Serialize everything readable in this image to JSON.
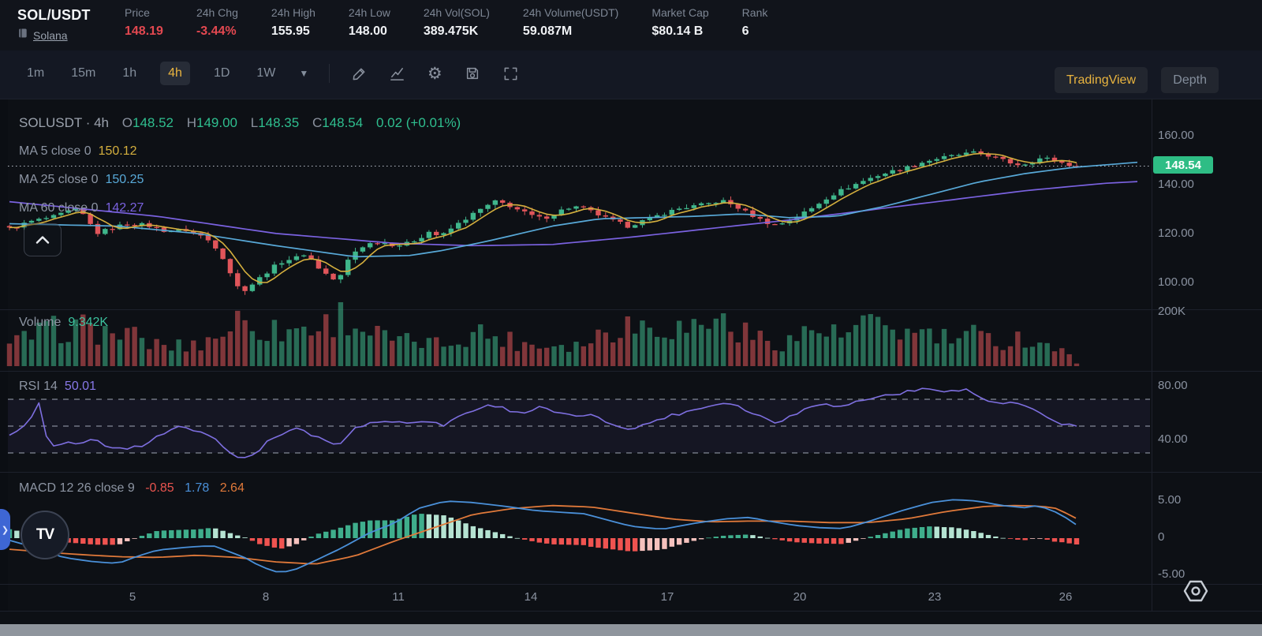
{
  "header": {
    "symbol": "SOL/USDT",
    "network": "Solana",
    "stats": [
      {
        "label": "Price",
        "value": "148.19"
      },
      {
        "label": "24h Chg",
        "value": "-3.44%"
      },
      {
        "label": "24h High",
        "value": "155.95"
      },
      {
        "label": "24h Low",
        "value": "148.00"
      },
      {
        "label": "24h Vol(SOL)",
        "value": "389.475K"
      },
      {
        "label": "24h Volume(USDT)",
        "value": "59.087M"
      },
      {
        "label": "Market Cap",
        "value": "$80.14 B"
      },
      {
        "label": "Rank",
        "value": "6"
      }
    ]
  },
  "toolbar": {
    "timeframes": [
      "1m",
      "15m",
      "1h",
      "4h",
      "1D",
      "1W"
    ],
    "active_timeframe": "4h",
    "view_buttons": {
      "tradingview": "TradingView",
      "depth": "Depth"
    }
  },
  "legend": {
    "symbol_interval": "SOLUSDT · 4h",
    "ohlc": {
      "o_label": "O",
      "o": "148.52",
      "h_label": "H",
      "h": "149.00",
      "l_label": "L",
      "l": "148.35",
      "c_label": "C",
      "c": "148.54",
      "change": "0.02 (+0.01%)"
    },
    "ma5": {
      "label": "MA 5 close 0",
      "value": "150.12"
    },
    "ma25": {
      "label": "MA 25 close 0",
      "value": "150.25"
    },
    "ma60": {
      "label": "MA 60 close 0",
      "value": "142.27"
    },
    "volume": {
      "label": "Volume",
      "value": "9.342K"
    },
    "rsi": {
      "label": "RSI 14",
      "value": "50.01"
    },
    "macd": {
      "label": "MACD 12 26 close 9",
      "hist": "-0.85",
      "macd": "1.78",
      "signal": "2.64"
    }
  },
  "colors": {
    "accent_gold": "#e9b43f",
    "stat_red": "#e34850",
    "up_green": "#3fb68b",
    "down_red": "#e0555a",
    "price_badge": "#2ebd85",
    "ma5": "#d4af3e",
    "ma25": "#58a9d8",
    "ma60": "#7a62e0",
    "rsi": "#7e6fe0",
    "macd_line": "#4a90d9",
    "macd_signal": "#e0793a",
    "hist_up": "#3fae8c",
    "hist_up_fade": "#b5e3d2",
    "hist_down": "#ef5350",
    "hist_down_fade": "#f5c1bd"
  },
  "chart_data": {
    "type": "candlestick",
    "symbol": "SOLUSDT",
    "interval": "4h",
    "ohlc_current": {
      "open": 148.52,
      "high": 149.0,
      "low": 148.35,
      "close": 148.54,
      "change": 0.02,
      "change_pct": "+0.01%"
    },
    "price_axis": {
      "labels": [
        "160.00",
        "140.00",
        "120.00",
        "100.00"
      ],
      "values": [
        160,
        140,
        120,
        100
      ],
      "last_price": 148.54,
      "last_price_label": "148.54",
      "range": [
        93,
        166
      ]
    },
    "time_axis": {
      "labels": [
        "5",
        "8",
        "11",
        "14",
        "17",
        "20",
        "23",
        "26"
      ]
    },
    "volume_axis": {
      "labels": [
        "200K"
      ],
      "max_thousands": 200,
      "current": 9.342
    },
    "rsi_axis": {
      "labels": [
        "80.00",
        "40.00"
      ],
      "levels": [
        70,
        50,
        30
      ],
      "current": 50.01
    },
    "macd_axis": {
      "labels": [
        "5.00",
        "0",
        "-5.00"
      ],
      "current": {
        "hist": -0.85,
        "macd": 1.78,
        "signal": 2.64
      }
    },
    "candles": {
      "count": 146,
      "close_keyframes": [
        [
          12,
          123
        ],
        [
          40,
          126
        ],
        [
          70,
          128
        ],
        [
          95,
          131
        ],
        [
          108,
          128
        ],
        [
          122,
          121
        ],
        [
          140,
          123
        ],
        [
          160,
          125
        ],
        [
          185,
          124.5
        ],
        [
          210,
          122
        ],
        [
          235,
          122.5
        ],
        [
          255,
          120
        ],
        [
          270,
          117
        ],
        [
          283,
          111
        ],
        [
          295,
          103
        ],
        [
          305,
          97
        ],
        [
          315,
          99
        ],
        [
          330,
          103
        ],
        [
          345,
          107
        ],
        [
          360,
          110
        ],
        [
          375,
          111
        ],
        [
          388,
          113
        ],
        [
          400,
          108
        ],
        [
          415,
          104
        ],
        [
          428,
          101
        ],
        [
          441,
          110
        ],
        [
          454,
          115
        ],
        [
          470,
          117
        ],
        [
          486,
          117.5
        ],
        [
          502,
          116
        ],
        [
          517,
          117
        ],
        [
          531,
          119
        ],
        [
          545,
          122
        ],
        [
          558,
          119.5
        ],
        [
          572,
          123
        ],
        [
          590,
          127
        ],
        [
          610,
          131
        ],
        [
          628,
          134
        ],
        [
          642,
          133
        ],
        [
          658,
          130.5
        ],
        [
          672,
          128.5
        ],
        [
          688,
          127
        ],
        [
          702,
          129
        ],
        [
          715,
          131
        ],
        [
          728,
          132
        ],
        [
          742,
          131
        ],
        [
          756,
          129
        ],
        [
          770,
          127
        ],
        [
          783,
          125.5
        ],
        [
          796,
          124
        ],
        [
          809,
          125.5
        ],
        [
          823,
          127
        ],
        [
          840,
          129
        ],
        [
          858,
          131
        ],
        [
          876,
          132
        ],
        [
          895,
          133
        ],
        [
          915,
          134.5
        ],
        [
          933,
          132
        ],
        [
          950,
          129
        ],
        [
          965,
          126.5
        ],
        [
          980,
          124.5
        ],
        [
          995,
          125.5
        ],
        [
          1010,
          128
        ],
        [
          1028,
          131
        ],
        [
          1045,
          135
        ],
        [
          1062,
          138
        ],
        [
          1080,
          140.5
        ],
        [
          1098,
          143
        ],
        [
          1115,
          145
        ],
        [
          1132,
          146.5
        ],
        [
          1150,
          148
        ],
        [
          1168,
          150
        ],
        [
          1186,
          151.5
        ],
        [
          1204,
          152.5
        ],
        [
          1222,
          153.5
        ],
        [
          1238,
          154
        ],
        [
          1252,
          153
        ],
        [
          1266,
          151.5
        ],
        [
          1280,
          150
        ],
        [
          1294,
          149
        ],
        [
          1308,
          150.5
        ],
        [
          1322,
          152
        ],
        [
          1336,
          151
        ],
        [
          1350,
          149.5
        ],
        [
          1365,
          148.5
        ]
      ]
    },
    "ma25_keyframes": [
      [
        12,
        125
      ],
      [
        150,
        124
      ],
      [
        250,
        121
      ],
      [
        350,
        116
      ],
      [
        450,
        111.5
      ],
      [
        520,
        112
      ],
      [
        560,
        114
      ],
      [
        620,
        118
      ],
      [
        700,
        124
      ],
      [
        760,
        127
      ],
      [
        820,
        127.5
      ],
      [
        880,
        128
      ],
      [
        940,
        129
      ],
      [
        1000,
        127.5
      ],
      [
        1060,
        128
      ],
      [
        1120,
        132
      ],
      [
        1180,
        137
      ],
      [
        1240,
        142
      ],
      [
        1300,
        145.5
      ],
      [
        1360,
        148
      ],
      [
        1446,
        150.2
      ]
    ],
    "ma60_keyframes": [
      [
        12,
        134
      ],
      [
        200,
        128
      ],
      [
        350,
        121
      ],
      [
        500,
        117
      ],
      [
        600,
        116
      ],
      [
        700,
        116.5
      ],
      [
        800,
        119.5
      ],
      [
        900,
        123
      ],
      [
        1000,
        126.5
      ],
      [
        1100,
        130.5
      ],
      [
        1200,
        134.5
      ],
      [
        1300,
        138.5
      ],
      [
        1400,
        141.5
      ],
      [
        1446,
        142.3
      ]
    ],
    "volume_keyframes": [
      [
        12,
        70
      ],
      [
        40,
        110
      ],
      [
        70,
        130
      ],
      [
        100,
        140
      ],
      [
        130,
        120
      ],
      [
        160,
        115
      ],
      [
        190,
        80
      ],
      [
        220,
        70
      ],
      [
        250,
        78
      ],
      [
        280,
        115
      ],
      [
        300,
        165
      ],
      [
        320,
        150
      ],
      [
        340,
        130
      ],
      [
        360,
        122
      ],
      [
        380,
        140
      ],
      [
        400,
        132
      ],
      [
        420,
        160
      ],
      [
        435,
        185
      ],
      [
        450,
        150
      ],
      [
        470,
        120
      ],
      [
        490,
        100
      ],
      [
        510,
        82
      ],
      [
        530,
        92
      ],
      [
        550,
        76
      ],
      [
        570,
        86
      ],
      [
        590,
        112
      ],
      [
        610,
        122
      ],
      [
        630,
        102
      ],
      [
        650,
        92
      ],
      [
        670,
        80
      ],
      [
        690,
        72
      ],
      [
        710,
        86
      ],
      [
        730,
        76
      ],
      [
        750,
        96
      ],
      [
        770,
        132
      ],
      [
        790,
        152
      ],
      [
        810,
        146
      ],
      [
        830,
        152
      ],
      [
        850,
        142
      ],
      [
        870,
        132
      ],
      [
        890,
        156
      ],
      [
        910,
        172
      ],
      [
        930,
        132
      ],
      [
        950,
        112
      ],
      [
        970,
        92
      ],
      [
        990,
        86
      ],
      [
        1010,
        102
      ],
      [
        1030,
        132
      ],
      [
        1050,
        122
      ],
      [
        1070,
        96
      ],
      [
        1090,
        152
      ],
      [
        1110,
        132
      ],
      [
        1130,
        146
      ],
      [
        1150,
        112
      ],
      [
        1170,
        122
      ],
      [
        1190,
        102
      ],
      [
        1210,
        92
      ],
      [
        1230,
        112
      ],
      [
        1250,
        96
      ],
      [
        1270,
        86
      ],
      [
        1290,
        102
      ],
      [
        1310,
        92
      ],
      [
        1330,
        76
      ],
      [
        1350,
        46
      ],
      [
        1365,
        10
      ]
    ],
    "rsi_keyframes": [
      [
        12,
        44
      ],
      [
        35,
        52
      ],
      [
        50,
        67
      ],
      [
        62,
        33
      ],
      [
        80,
        38
      ],
      [
        100,
        36
      ],
      [
        120,
        40
      ],
      [
        140,
        34
      ],
      [
        160,
        32
      ],
      [
        180,
        36
      ],
      [
        205,
        44
      ],
      [
        225,
        49
      ],
      [
        245,
        47
      ],
      [
        265,
        42
      ],
      [
        285,
        35
      ],
      [
        305,
        24
      ],
      [
        320,
        28
      ],
      [
        340,
        39
      ],
      [
        360,
        45
      ],
      [
        380,
        48
      ],
      [
        400,
        42
      ],
      [
        418,
        38
      ],
      [
        432,
        36
      ],
      [
        445,
        47
      ],
      [
        465,
        52
      ],
      [
        490,
        54
      ],
      [
        515,
        52
      ],
      [
        540,
        55
      ],
      [
        560,
        50
      ],
      [
        580,
        57
      ],
      [
        605,
        63
      ],
      [
        625,
        66
      ],
      [
        645,
        62
      ],
      [
        665,
        60
      ],
      [
        685,
        64
      ],
      [
        705,
        60
      ],
      [
        725,
        57
      ],
      [
        745,
        59
      ],
      [
        765,
        54
      ],
      [
        785,
        50
      ],
      [
        805,
        48
      ],
      [
        825,
        53
      ],
      [
        845,
        57
      ],
      [
        865,
        60
      ],
      [
        885,
        63
      ],
      [
        905,
        66
      ],
      [
        925,
        68
      ],
      [
        945,
        62
      ],
      [
        965,
        57
      ],
      [
        985,
        53
      ],
      [
        1005,
        58
      ],
      [
        1025,
        64
      ],
      [
        1045,
        68
      ],
      [
        1065,
        64
      ],
      [
        1085,
        68
      ],
      [
        1105,
        71
      ],
      [
        1125,
        73
      ],
      [
        1145,
        75
      ],
      [
        1165,
        77
      ],
      [
        1185,
        78
      ],
      [
        1205,
        76
      ],
      [
        1225,
        77
      ],
      [
        1245,
        71
      ],
      [
        1265,
        66
      ],
      [
        1285,
        68
      ],
      [
        1305,
        63
      ],
      [
        1325,
        57
      ],
      [
        1345,
        52
      ],
      [
        1365,
        50
      ]
    ],
    "macd_keyframes": [
      [
        12,
        -0.3
      ],
      [
        50,
        -1.4
      ],
      [
        80,
        -2.6
      ],
      [
        120,
        -3.2
      ],
      [
        150,
        -3.4
      ],
      [
        175,
        -2.4
      ],
      [
        200,
        -1.6
      ],
      [
        240,
        -1.2
      ],
      [
        270,
        -1.0
      ],
      [
        290,
        -1.8
      ],
      [
        310,
        -2.6
      ],
      [
        330,
        -3.8
      ],
      [
        355,
        -4.7
      ],
      [
        375,
        -4.2
      ],
      [
        400,
        -3.0
      ],
      [
        430,
        -1.5
      ],
      [
        470,
        0.8
      ],
      [
        500,
        2.0
      ],
      [
        530,
        4.0
      ],
      [
        565,
        5.0
      ],
      [
        600,
        4.8
      ],
      [
        640,
        4.3
      ],
      [
        680,
        3.7
      ],
      [
        740,
        3.3
      ],
      [
        800,
        1.6
      ],
      [
        840,
        1.2
      ],
      [
        880,
        2.0
      ],
      [
        920,
        2.6
      ],
      [
        950,
        2.8
      ],
      [
        980,
        2.2
      ],
      [
        1010,
        1.7
      ],
      [
        1040,
        1.4
      ],
      [
        1070,
        1.3
      ],
      [
        1100,
        2.2
      ],
      [
        1140,
        3.6
      ],
      [
        1180,
        4.8
      ],
      [
        1210,
        5.2
      ],
      [
        1240,
        5.0
      ],
      [
        1270,
        4.4
      ],
      [
        1300,
        4.1
      ],
      [
        1315,
        4.4
      ],
      [
        1330,
        3.9
      ],
      [
        1345,
        3.2
      ],
      [
        1365,
        1.78
      ]
    ],
    "signal_keyframes": [
      [
        12,
        -1.5
      ],
      [
        60,
        -1.9
      ],
      [
        100,
        -2.2
      ],
      [
        150,
        -2.5
      ],
      [
        200,
        -2.6
      ],
      [
        250,
        -2.3
      ],
      [
        300,
        -2.6
      ],
      [
        350,
        -3.2
      ],
      [
        400,
        -3.5
      ],
      [
        450,
        -2.4
      ],
      [
        500,
        -0.4
      ],
      [
        550,
        1.4
      ],
      [
        600,
        3.2
      ],
      [
        650,
        4.0
      ],
      [
        700,
        4.4
      ],
      [
        750,
        4.2
      ],
      [
        800,
        3.4
      ],
      [
        850,
        2.6
      ],
      [
        900,
        2.2
      ],
      [
        950,
        2.3
      ],
      [
        1000,
        2.3
      ],
      [
        1050,
        2.1
      ],
      [
        1100,
        2.1
      ],
      [
        1150,
        2.6
      ],
      [
        1200,
        3.6
      ],
      [
        1250,
        4.3
      ],
      [
        1290,
        4.4
      ],
      [
        1320,
        4.3
      ],
      [
        1340,
        4.0
      ],
      [
        1365,
        2.64
      ]
    ]
  }
}
